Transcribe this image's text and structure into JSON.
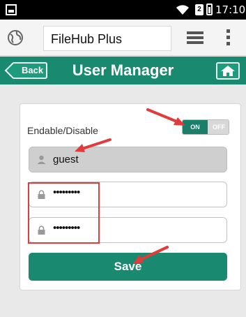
{
  "status_bar": {
    "time": "17:10",
    "sim_label": "2",
    "icons": [
      "image-icon",
      "wifi-icon",
      "sim-icon",
      "battery-icon"
    ]
  },
  "browser": {
    "url": "FileHub Plus",
    "icons": [
      "globe-icon",
      "tabs-icon",
      "menu-icon"
    ]
  },
  "app": {
    "back_label": "Back",
    "title": "User Manager",
    "home_icon": "home-icon",
    "accent_color": "#198a6f"
  },
  "form": {
    "toggle_label": "Endable/Disable",
    "toggle_on": "ON",
    "toggle_off": "OFF",
    "toggle_state": "on",
    "username": "guest",
    "password": "•••••••••",
    "confirm_password": "•••••••••",
    "save_label": "Save"
  },
  "annotations": {
    "color": "#e13b3b"
  }
}
